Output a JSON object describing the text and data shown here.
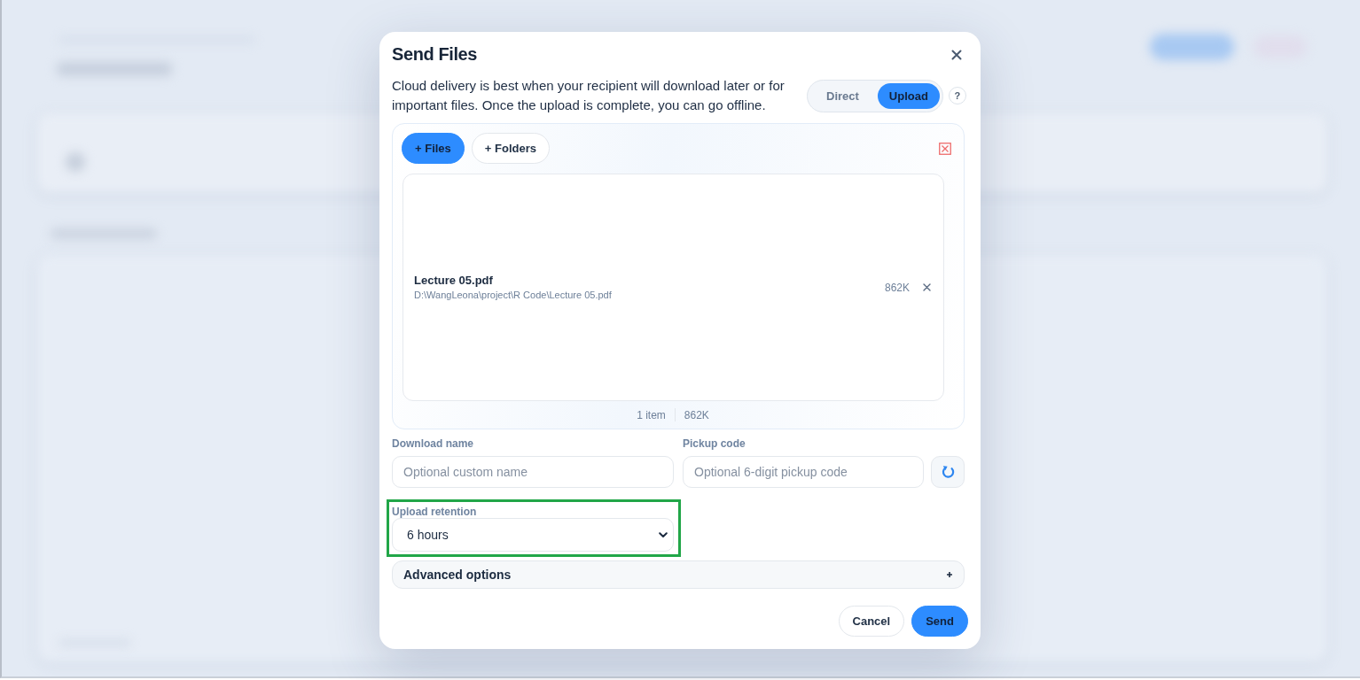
{
  "dialog": {
    "title": "Send Files",
    "description": "Cloud delivery is best when your recipient will download later or for important files. Once the upload is complete, you can go offline.",
    "modes": [
      {
        "label": "Direct",
        "selected": false
      },
      {
        "label": "Upload",
        "selected": true
      }
    ],
    "help": "?",
    "add_buttons": [
      {
        "label": "+ Files",
        "kind": "primary"
      },
      {
        "label": "+ Folders",
        "kind": "secondary"
      }
    ],
    "files": [
      {
        "name": "Lecture 05.pdf",
        "path": "D:\\WangLeona\\project\\R Code\\Lecture 05.pdf",
        "size": "862K"
      }
    ],
    "summary": {
      "count": "1 item",
      "size": "862K"
    },
    "fields": [
      {
        "label": "Download name",
        "placeholder": "Optional custom name"
      },
      {
        "label": "Pickup code",
        "placeholder": "Optional 6-digit pickup code"
      }
    ],
    "retention": {
      "label": "Upload retention",
      "value": "6 hours",
      "highlighted": true
    },
    "advanced": {
      "label": "Advanced options",
      "expanded": false
    },
    "actions": [
      {
        "label": "Cancel",
        "kind": "secondary"
      },
      {
        "label": "Send",
        "kind": "primary"
      }
    ]
  }
}
